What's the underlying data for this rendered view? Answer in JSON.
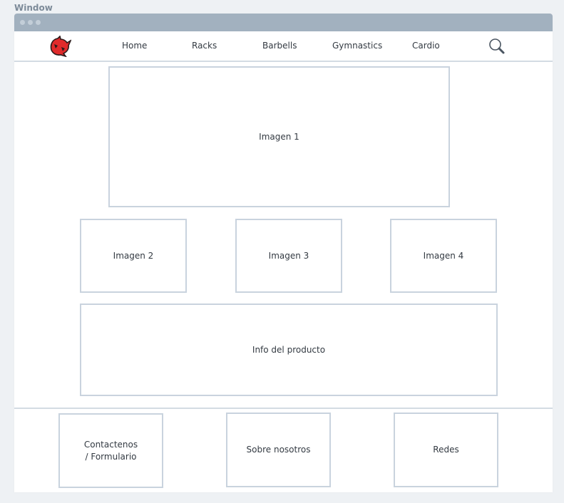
{
  "window": {
    "title": "Window"
  },
  "nav": {
    "items": [
      "Home",
      "Racks",
      "Barbells",
      "Gymnastics",
      "Cardio"
    ],
    "logo_icon": "rhino-logo-icon",
    "search_icon": "search-icon",
    "logo_color": "#e02b2b"
  },
  "main": {
    "hero": "Imagen 1",
    "thumbs": [
      "Imagen 2",
      "Imagen 3",
      "Imagen 4"
    ],
    "info": "Info del producto"
  },
  "footer": {
    "contact_line1": "Contactenos",
    "contact_line2": "/ Formulario",
    "about": "Sobre nosotros",
    "social": "Redes"
  }
}
